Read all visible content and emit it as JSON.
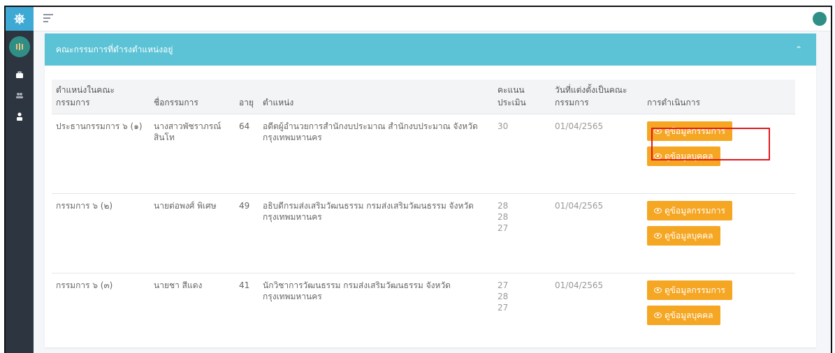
{
  "card": {
    "title": "คณะกรรมการที่ดำรงตำแหน่งอยู่",
    "collapse_icon": "chevron-up-icon",
    "header_color": "#5bc3d5"
  },
  "table": {
    "headers": {
      "position": "ตำแหน่งในคณะกรรมการ",
      "name": "ชื่อกรรมการ",
      "age": "อายุ",
      "title": "ตำแหน่ง",
      "score": "คะแนนประเมิน",
      "appointed": "วันที่แต่งตั้งเป็นคณะกรรมการ",
      "action": "การดำเนินการ"
    },
    "rows": [
      {
        "position": "ประธานกรรมการ ๖ (๑)",
        "name": "นางสาวพัชราภรณ์ สินโท",
        "age": "64",
        "title": "อดีตผู้อำนวยการสำนักงบประมาณ สำนักงบประมาณ จังหวัดกรุงเทพมหานคร",
        "scores": [
          "30"
        ],
        "appointed": "01/04/2565"
      },
      {
        "position": "กรรมการ ๖ (๒)",
        "name": "นายต่อพงศ์ พิเศษ",
        "age": "49",
        "title": "อธิบดีกรมส่งเสริมวัฒนธรรม กรมส่งเสริมวัฒนธรรม จังหวัดกรุงเทพมหานคร",
        "scores": [
          "28",
          "28",
          "27"
        ],
        "appointed": "01/04/2565"
      },
      {
        "position": "กรรมการ ๖ (๓)",
        "name": "นายชา สีแดง",
        "age": "41",
        "title": "นักวิชาการวัฒนธรรม กรมส่งเสริมวัฒนธรรม จังหวัดกรุงเทพมหานคร",
        "scores": [
          "27",
          "28",
          "27"
        ],
        "appointed": "01/04/2565"
      }
    ]
  },
  "buttons": {
    "view_committee": "ดูข้อมูลกรรมการ",
    "view_person": "ดูข้อมูลบุคคล",
    "color": "#f5a623"
  },
  "highlight_color": "#e0191f"
}
